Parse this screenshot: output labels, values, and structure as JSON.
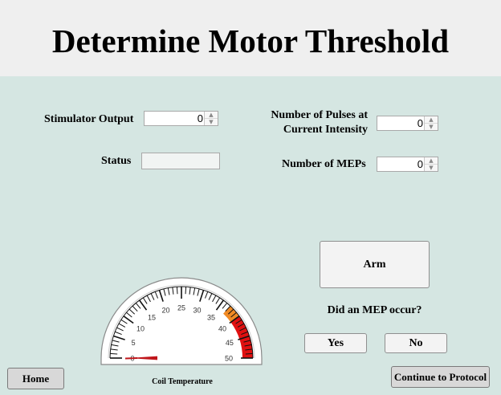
{
  "header": {
    "title": "Determine Motor Threshold"
  },
  "form": {
    "stimulator_output": {
      "label": "Stimulator Output",
      "value": "0"
    },
    "status": {
      "label": "Status",
      "value": ""
    },
    "pulses": {
      "label_line1": "Number of Pulses at",
      "label_line2": "Current Intensity",
      "value": "0"
    },
    "meps": {
      "label": "Number of MEPs",
      "value": "0"
    }
  },
  "controls": {
    "arm_label": "Arm",
    "question": "Did an MEP occur?",
    "yes_label": "Yes",
    "no_label": "No"
  },
  "gauge": {
    "label": "Coil Temperature",
    "min": 0,
    "max": 50,
    "value": 0,
    "major_ticks": [
      "0",
      "5",
      "10",
      "15",
      "20",
      "25",
      "30",
      "35",
      "40",
      "45",
      "50"
    ],
    "warning_range": [
      37,
      40
    ],
    "danger_range": [
      40,
      50
    ],
    "warning_color": "#f08a24",
    "danger_color": "#e01010",
    "needle_color": "#c0161b"
  },
  "footer": {
    "home_label": "Home",
    "continue_label": "Continue to Protocol"
  }
}
